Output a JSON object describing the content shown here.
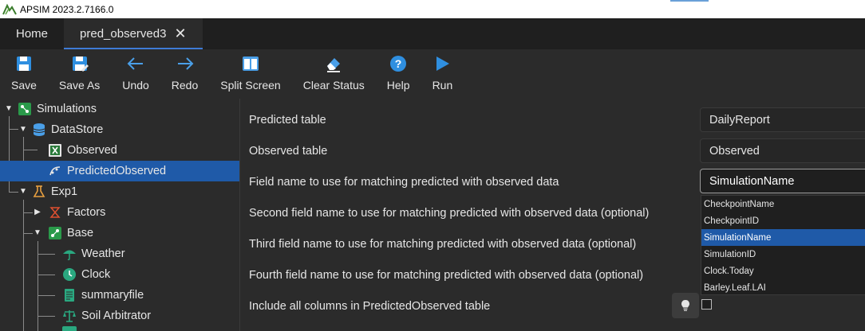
{
  "window": {
    "title": "APSIM 2023.2.7166.0"
  },
  "tabs": [
    {
      "label": "Home"
    },
    {
      "label": "pred_observed3",
      "close": "✕"
    }
  ],
  "toolbar": {
    "save": "Save",
    "save_as": "Save As",
    "undo": "Undo",
    "redo": "Redo",
    "split_screen": "Split Screen",
    "clear_status": "Clear Status",
    "help": "Help",
    "run": "Run"
  },
  "tree": {
    "simulations": "Simulations",
    "datastore": "DataStore",
    "observed": "Observed",
    "predicted_observed": "PredictedObserved",
    "exp1": "Exp1",
    "factors": "Factors",
    "base": "Base",
    "weather": "Weather",
    "clock": "Clock",
    "summaryfile": "summaryfile",
    "soil_arbitrator": "Soil Arbitrator"
  },
  "properties": {
    "predicted_table_label": "Predicted table",
    "predicted_table_value": "DailyReport",
    "observed_table_label": "Observed table",
    "observed_table_value": "Observed",
    "field_name_label": "Field name to use for matching predicted with observed data",
    "field_name_value": "SimulationName",
    "second_field_label": "Second field name to use for matching predicted with observed data (optional)",
    "third_field_label": "Third field name to use for matching predicted with observed data (optional)",
    "fourth_field_label": "Fourth field name to use for matching predicted with observed data (optional)",
    "include_all_label": "Include all columns in PredictedObserved table",
    "include_all_checked": false
  },
  "dropdown": {
    "options": [
      "CheckpointName",
      "CheckpointID",
      "SimulationName",
      "SimulationID",
      "Clock.Today",
      "Barley.Leaf.LAI"
    ],
    "selected": "SimulationName"
  },
  "colors": {
    "background": "#2b2b2b",
    "selection": "#1f5aa8",
    "accent": "#3e7bd6"
  }
}
